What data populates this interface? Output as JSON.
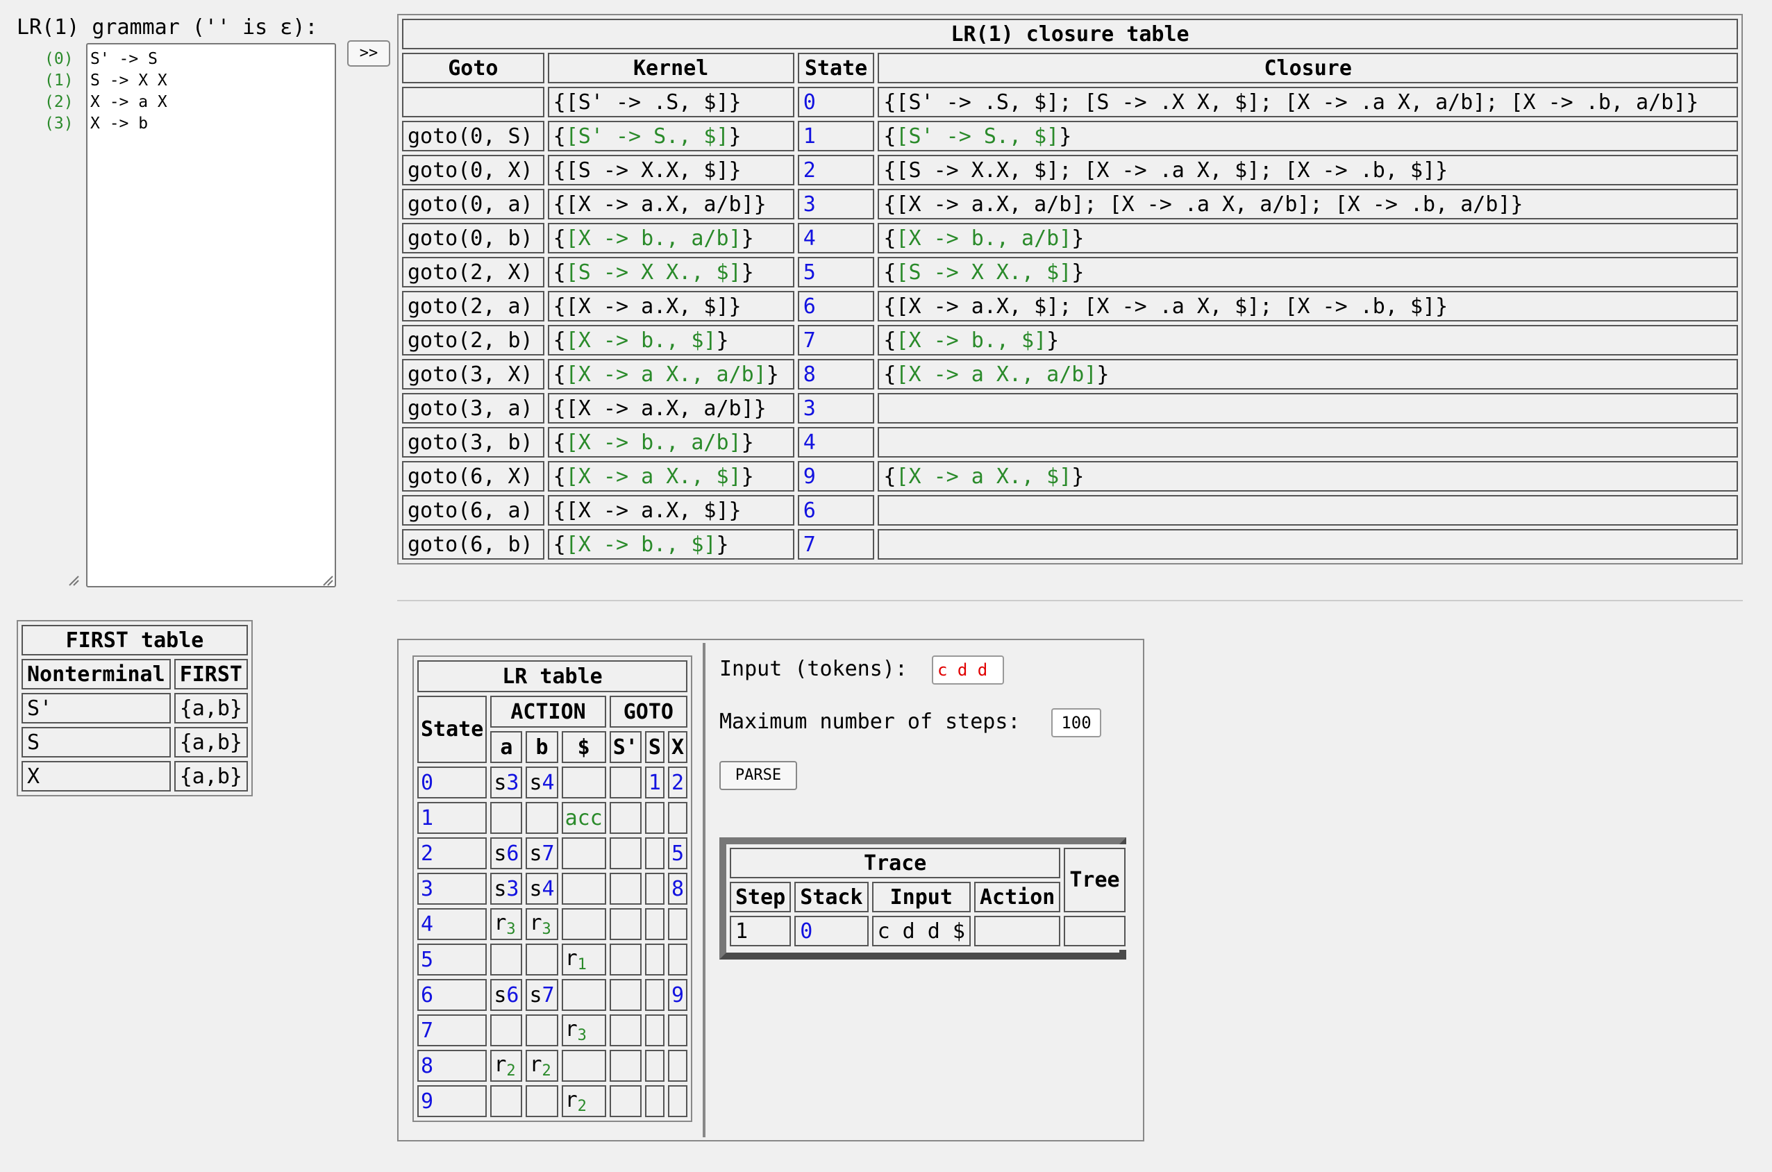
{
  "grammar": {
    "title": "LR(1) grammar ('' is ε):",
    "rules": [
      {
        "num": "(0)",
        "text": "S' -> S"
      },
      {
        "num": "(1)",
        "text": "S -> X X"
      },
      {
        "num": "(2)",
        "text": "X -> a X"
      },
      {
        "num": "(3)",
        "text": "X -> b"
      }
    ],
    "build_button": ">>"
  },
  "closure_table": {
    "title": "LR(1) closure table",
    "headers": [
      "Goto",
      "Kernel",
      "State",
      "Closure"
    ],
    "rows": [
      {
        "goto": "",
        "kernel": "{[S' -> .S, $]}",
        "kernel_green": false,
        "state": "0",
        "closure": "{[S' -> .S, $]; [S -> .X X, $]; [X -> .a X, a/b]; [X -> .b, a/b]}",
        "closure_green": false
      },
      {
        "goto": "goto(0, S)",
        "kernel": "[S' -> S., $]",
        "kernel_green": true,
        "state": "1",
        "closure": "[S' -> S., $]",
        "closure_green": true
      },
      {
        "goto": "goto(0, X)",
        "kernel": "{[S -> X.X, $]}",
        "kernel_green": false,
        "state": "2",
        "closure": "{[S -> X.X, $]; [X -> .a X, $]; [X -> .b, $]}",
        "closure_green": false
      },
      {
        "goto": "goto(0, a)",
        "kernel": "{[X -> a.X, a/b]}",
        "kernel_green": false,
        "state": "3",
        "closure": "{[X -> a.X, a/b]; [X -> .a X, a/b]; [X -> .b, a/b]}",
        "closure_green": false
      },
      {
        "goto": "goto(0, b)",
        "kernel": "[X -> b., a/b]",
        "kernel_green": true,
        "state": "4",
        "closure": "[X -> b., a/b]",
        "closure_green": true
      },
      {
        "goto": "goto(2, X)",
        "kernel": "[S -> X X., $]",
        "kernel_green": true,
        "state": "5",
        "closure": "[S -> X X., $]",
        "closure_green": true
      },
      {
        "goto": "goto(2, a)",
        "kernel": "{[X -> a.X, $]}",
        "kernel_green": false,
        "state": "6",
        "closure": "{[X -> a.X, $]; [X -> .a X, $]; [X -> .b, $]}",
        "closure_green": false
      },
      {
        "goto": "goto(2, b)",
        "kernel": "[X -> b., $]",
        "kernel_green": true,
        "state": "7",
        "closure": "[X -> b., $]",
        "closure_green": true
      },
      {
        "goto": "goto(3, X)",
        "kernel": "[X -> a X., a/b]",
        "kernel_green": true,
        "state": "8",
        "closure": "[X -> a X., a/b]",
        "closure_green": true
      },
      {
        "goto": "goto(3, a)",
        "kernel": "{[X -> a.X, a/b]}",
        "kernel_green": false,
        "state": "3",
        "closure": "",
        "closure_green": false
      },
      {
        "goto": "goto(3, b)",
        "kernel": "[X -> b., a/b]",
        "kernel_green": true,
        "state": "4",
        "closure": "",
        "closure_green": false
      },
      {
        "goto": "goto(6, X)",
        "kernel": "[X -> a X., $]",
        "kernel_green": true,
        "state": "9",
        "closure": "[X -> a X., $]",
        "closure_green": true
      },
      {
        "goto": "goto(6, a)",
        "kernel": "{[X -> a.X, $]}",
        "kernel_green": false,
        "state": "6",
        "closure": "",
        "closure_green": false
      },
      {
        "goto": "goto(6, b)",
        "kernel": "[X -> b., $]",
        "kernel_green": true,
        "state": "7",
        "closure": "",
        "closure_green": false
      }
    ]
  },
  "first_table": {
    "title": "FIRST table",
    "headers": [
      "Nonterminal",
      "FIRST"
    ],
    "rows": [
      {
        "nt": "S'",
        "first": "{a,b}"
      },
      {
        "nt": "S",
        "first": "{a,b}"
      },
      {
        "nt": "X",
        "first": "{a,b}"
      }
    ]
  },
  "lr_table": {
    "title": "LR table",
    "state_header": "State",
    "action_header": "ACTION",
    "goto_header": "GOTO",
    "columns": [
      "a",
      "b",
      "$",
      "S'",
      "S",
      "X"
    ],
    "rows": [
      {
        "state": "0",
        "cells": [
          {
            "k": "s",
            "n": "3"
          },
          {
            "k": "s",
            "n": "4"
          },
          null,
          null,
          {
            "k": "g",
            "n": "1"
          },
          {
            "k": "g",
            "n": "2"
          }
        ]
      },
      {
        "state": "1",
        "cells": [
          null,
          null,
          {
            "k": "acc",
            "n": "acc"
          },
          null,
          null,
          null
        ]
      },
      {
        "state": "2",
        "cells": [
          {
            "k": "s",
            "n": "6"
          },
          {
            "k": "s",
            "n": "7"
          },
          null,
          null,
          null,
          {
            "k": "g",
            "n": "5"
          }
        ]
      },
      {
        "state": "3",
        "cells": [
          {
            "k": "s",
            "n": "3"
          },
          {
            "k": "s",
            "n": "4"
          },
          null,
          null,
          null,
          {
            "k": "g",
            "n": "8"
          }
        ]
      },
      {
        "state": "4",
        "cells": [
          {
            "k": "r",
            "n": "3"
          },
          {
            "k": "r",
            "n": "3"
          },
          null,
          null,
          null,
          null
        ]
      },
      {
        "state": "5",
        "cells": [
          null,
          null,
          {
            "k": "r",
            "n": "1"
          },
          null,
          null,
          null
        ]
      },
      {
        "state": "6",
        "cells": [
          {
            "k": "s",
            "n": "6"
          },
          {
            "k": "s",
            "n": "7"
          },
          null,
          null,
          null,
          {
            "k": "g",
            "n": "9"
          }
        ]
      },
      {
        "state": "7",
        "cells": [
          null,
          null,
          {
            "k": "r",
            "n": "3"
          },
          null,
          null,
          null
        ]
      },
      {
        "state": "8",
        "cells": [
          {
            "k": "r",
            "n": "2"
          },
          {
            "k": "r",
            "n": "2"
          },
          null,
          null,
          null,
          null
        ]
      },
      {
        "state": "9",
        "cells": [
          null,
          null,
          {
            "k": "r",
            "n": "2"
          },
          null,
          null,
          null
        ]
      }
    ],
    "shift_letter": "s",
    "reduce_letter": "r"
  },
  "parser": {
    "input_label": "Input (tokens):",
    "input_value": "c d d",
    "steps_label": "Maximum number of steps:",
    "steps_value": "100",
    "parse_button": "PARSE"
  },
  "trace": {
    "title": "Trace",
    "tree_header": "Tree",
    "headers": [
      "Step",
      "Stack",
      "Input",
      "Action"
    ],
    "rows": [
      {
        "step": "1",
        "stack": "0",
        "input": "c d d $",
        "action": "",
        "tree": ""
      }
    ]
  }
}
